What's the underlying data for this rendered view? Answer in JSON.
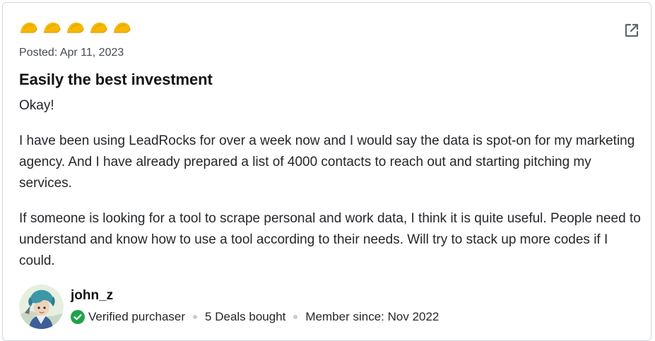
{
  "review": {
    "rating": 5,
    "rating_icon": "taco-icon",
    "rating_color": "#f5b800",
    "posted": "Posted: Apr 11, 2023",
    "title": "Easily the best investment",
    "paragraphs": [
      "Okay!",
      "I have been using LeadRocks for over a week now and I would say the data is spot-on for my marketing agency. And I have already prepared a list of 4000 contacts to reach out and starting pitching my services.",
      "If someone is looking for a tool to scrape personal and work data, I think it is quite useful. People need to understand and know how to use a tool according to their needs. Will try to stack up more codes if I could."
    ],
    "external_icon": "external-link-icon"
  },
  "reviewer": {
    "name": "john_z",
    "verified_label": "Verified purchaser",
    "verified_icon": "check-circle-icon",
    "verified_color": "#1fa34a",
    "deals_bought": "5 Deals bought",
    "member_since": "Member since: Nov 2022",
    "avatar_icon": "avatar"
  }
}
